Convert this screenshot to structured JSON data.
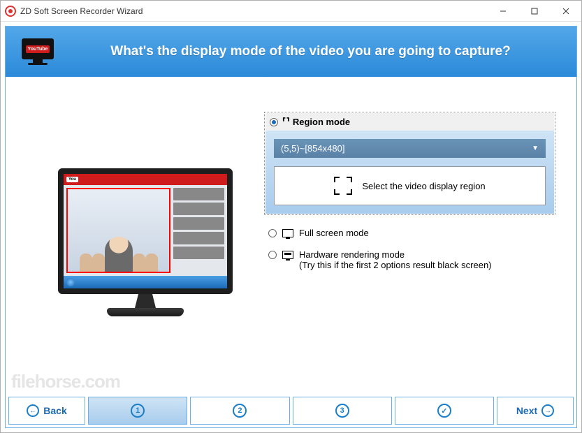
{
  "window": {
    "title": "ZD Soft Screen Recorder Wizard"
  },
  "header": {
    "question": "What's the display mode of the video you are going to capture?",
    "icon_badge": "YouTube"
  },
  "options": {
    "region": {
      "label": "Region mode",
      "selected": true,
      "dropdown_value": "(5,5)~[854x480]",
      "button_label": "Select the video display region"
    },
    "fullscreen": {
      "label": "Full screen mode",
      "selected": false
    },
    "hardware": {
      "label": "Hardware rendering mode",
      "hint": "(Try this if the first 2 options result black screen)",
      "selected": false
    }
  },
  "footer": {
    "back": "Back",
    "next": "Next",
    "steps": [
      "1",
      "2",
      "3",
      "✓"
    ],
    "active_step": 0
  },
  "watermark": "filehorse.com"
}
